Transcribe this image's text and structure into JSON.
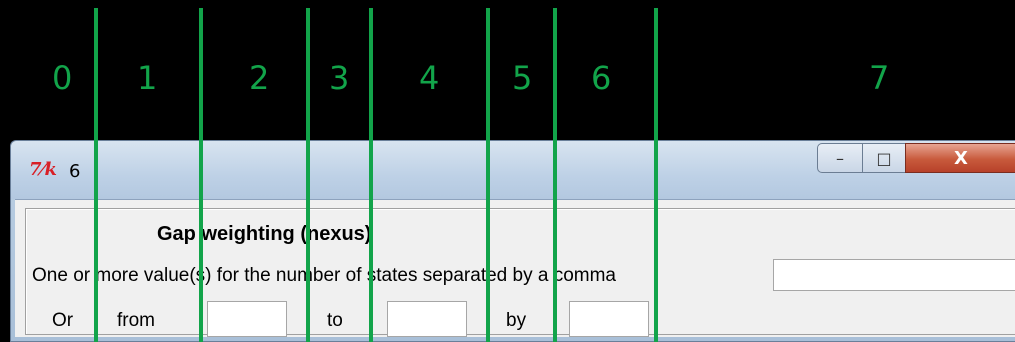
{
  "column_numbers": [
    "0",
    "1",
    "2",
    "3",
    "4",
    "5",
    "6",
    "7"
  ],
  "window": {
    "title": "6",
    "app_icon": "tk-feather-icon",
    "buttons": {
      "minimize": "–",
      "maximize": "□",
      "close": "X"
    }
  },
  "form": {
    "heading": "Gap weighting (nexus)",
    "values_label": "One or more value(s) for the number of states separated by a comma",
    "values_input": "",
    "or_label": "Or",
    "from_label": "from",
    "from_input": "",
    "to_label": "to",
    "to_input": "",
    "by_label": "by",
    "by_input": ""
  },
  "colors": {
    "annotation": "#12a44a",
    "background": "#000000"
  }
}
